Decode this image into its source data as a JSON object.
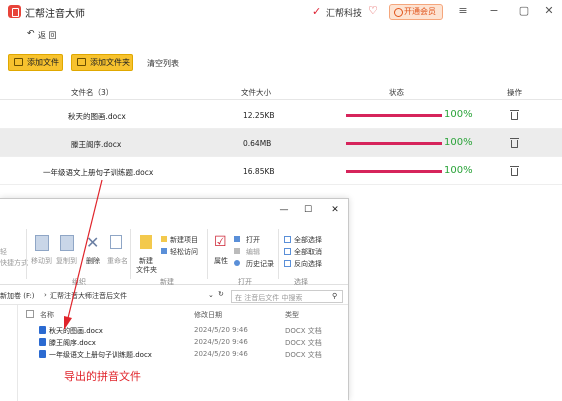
{
  "app": {
    "title": "汇帮注音大师",
    "brand": "汇帮科技",
    "vip_label": "开通会员"
  },
  "toolbar": {
    "back": "返 回",
    "add_file": "添加文件",
    "add_folder": "添加文件夹",
    "clear_list": "清空列表"
  },
  "table": {
    "headers": {
      "name": "文件名（3）",
      "size": "文件大小",
      "status": "状态",
      "action": "操作"
    },
    "rows": [
      {
        "name": "秋天的图画.docx",
        "size": "12.25KB",
        "percent": "100%",
        "progress": 1.0
      },
      {
        "name": "滕王阁序.docx",
        "size": "0.64MB",
        "percent": "100%",
        "progress": 1.0
      },
      {
        "name": "一年级语文上册句子训练题.docx",
        "size": "16.85KB",
        "percent": "100%",
        "progress": 1.0
      }
    ]
  },
  "explorer": {
    "ribbon": {
      "pin_l1": "轻",
      "pin_l2": "快捷方式",
      "move_to": "移动到",
      "copy_to": "复制到",
      "delete": "删除",
      "rename": "重命名",
      "organize": "组织",
      "new_item": "新建项目",
      "easy_access": "轻松访问",
      "new_folder_l1": "新建",
      "new_folder_l2": "文件夹",
      "new_group": "新建",
      "properties": "属性",
      "open": "打开",
      "edit": "编辑",
      "history": "历史记录",
      "open_group": "打开",
      "select_all": "全部选择",
      "select_none": "全部取消",
      "invert": "反向选择",
      "select_group": "选择"
    },
    "path": [
      "新加卷 (F:)",
      "汇帮注音大师",
      "注音后文件"
    ],
    "search_placeholder": "在 注音后文件 中搜索",
    "columns": {
      "name": "名称",
      "modified": "修改日期",
      "type": "类型"
    },
    "files": [
      {
        "name": "秋天的图画.docx",
        "modified": "2024/5/20 9:46",
        "type": "DOCX 文档"
      },
      {
        "name": "滕王阁序.docx",
        "modified": "2024/5/20 9:46",
        "type": "DOCX 文档"
      },
      {
        "name": "一年级语文上册句子训练题.docx",
        "modified": "2024/5/20 9:46",
        "type": "DOCX 文档"
      }
    ]
  },
  "annotation": "导出的拼音文件",
  "colors": {
    "accent": "#f7c22e",
    "progress": "#d6245b",
    "percent": "#2aa339",
    "annotation": "#e0242b"
  }
}
